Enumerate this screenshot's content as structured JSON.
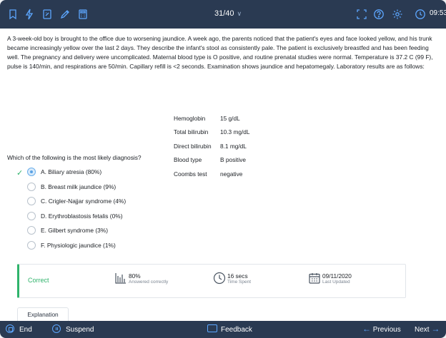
{
  "topbar": {
    "icons": [
      "bookmark-icon",
      "lab-values-icon",
      "notes-icon",
      "highlighter-icon",
      "calculator-icon"
    ],
    "counter": "31/40",
    "right_icons": [
      "fullscreen-icon",
      "help-icon",
      "settings-icon",
      "clock-icon"
    ],
    "timer": "09:53"
  },
  "stem": "A 3-week-old boy is brought to the office due to worsening jaundice.  A week ago, the parents noticed that the patient's eyes and face looked yellow, and his trunk became increasingly yellow over the last 2 days.  They describe the infant's stool as consistently pale.  The patient is exclusively breastfed and has been feeding well.  The pregnancy and delivery were uncomplicated.  Maternal blood type is O positive, and routine prenatal studies were normal.  Temperature is 37.2 C (99 F), pulse is 140/min, and respirations are 50/min.  Capillary refill is <2 seconds.  Examination shows jaundice and hepatomegaly.  Laboratory results are as follows:",
  "labs": [
    {
      "name": "Hemoglobin",
      "value": "15 g/dL"
    },
    {
      "name": "Total bilirubin",
      "value": "10.3 mg/dL"
    },
    {
      "name": "Direct bilirubin",
      "value": "8.1 mg/dL"
    },
    {
      "name": "Blood type",
      "value": "B positive"
    },
    {
      "name": "Coombs test",
      "value": "negative"
    }
  ],
  "question": "Which of the following is the most likely diagnosis?",
  "options": [
    {
      "text": "A.  Biliary atresia (80%)",
      "selected": true,
      "correct": true
    },
    {
      "text": "B.  Breast milk jaundice (9%)",
      "selected": false
    },
    {
      "text": "C.  Crigler-Najjar syndrome (4%)",
      "selected": false
    },
    {
      "text": "D.  Erythroblastosis fetalis (0%)",
      "selected": false
    },
    {
      "text": "E.  Gilbert syndrome (3%)",
      "selected": false
    },
    {
      "text": "F.  Physiologic jaundice (1%)",
      "selected": false
    }
  ],
  "result": {
    "status": "Correct",
    "percent": "80%",
    "percent_label": "Answered correctly",
    "time": "16 secs",
    "time_label": "Time Spent",
    "date": "09/11/2020",
    "date_label": "Last Updated"
  },
  "explanation_label": "Explanation",
  "bottombar": {
    "end": "End",
    "suspend": "Suspend",
    "feedback": "Feedback",
    "previous": "Previous",
    "next": "Next"
  },
  "colors": {
    "bar": "#2a3a52",
    "accent": "#5da7ff",
    "correct": "#2fb36b"
  }
}
